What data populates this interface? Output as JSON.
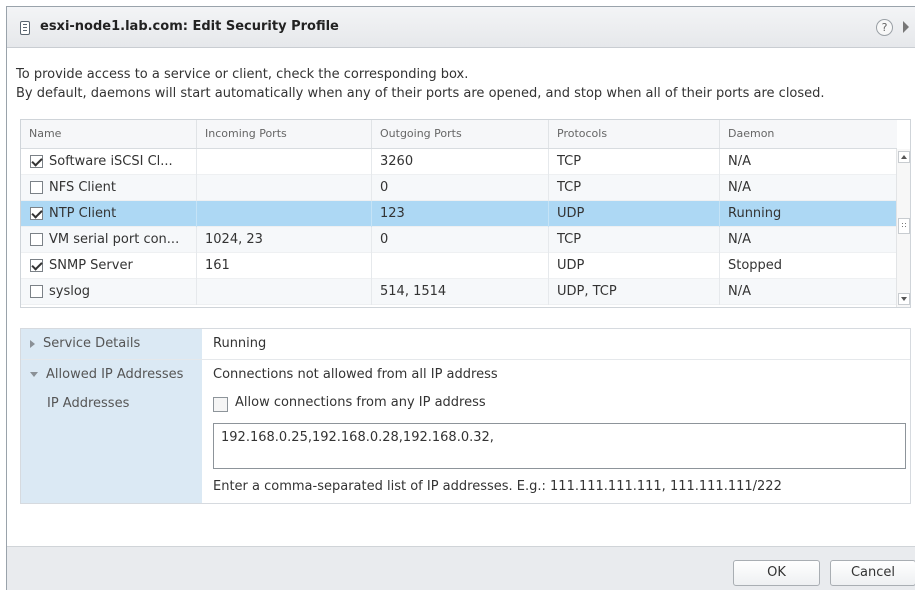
{
  "dialog": {
    "title": "esxi-node1.lab.com: Edit Security Profile",
    "help_glyph": "?",
    "intro_line1": "To provide access to a service or client, check the corresponding box.",
    "intro_line2": "By default, daemons will start automatically when any of their ports are opened, and stop when all of their ports are closed."
  },
  "grid": {
    "columns": [
      "Name",
      "Incoming Ports",
      "Outgoing Ports",
      "Protocols",
      "Daemon"
    ],
    "rows": [
      {
        "checked": true,
        "name": "Software iSCSI Cl...",
        "incoming": "",
        "outgoing": "3260",
        "protocols": "TCP",
        "daemon": "N/A"
      },
      {
        "checked": false,
        "name": "NFS Client",
        "incoming": "",
        "outgoing": "0",
        "protocols": "TCP",
        "daemon": "N/A"
      },
      {
        "checked": true,
        "name": "NTP Client",
        "incoming": "",
        "outgoing": "123",
        "protocols": "UDP",
        "daemon": "Running",
        "selected": true
      },
      {
        "checked": false,
        "name": "VM serial port con...",
        "incoming": "1024, 23",
        "outgoing": "0",
        "protocols": "TCP",
        "daemon": "N/A"
      },
      {
        "checked": true,
        "name": "SNMP Server",
        "incoming": "161",
        "outgoing": "",
        "protocols": "UDP",
        "daemon": "Stopped"
      },
      {
        "checked": false,
        "name": "syslog",
        "incoming": "",
        "outgoing": "514, 1514",
        "protocols": "UDP, TCP",
        "daemon": "N/A"
      }
    ]
  },
  "details": {
    "service_details_label": "Service Details",
    "service_details_value": "Running",
    "allowed_ip_label": "Allowed IP Addresses",
    "allowed_ip_value": "Connections not allowed from all IP address",
    "ip_addresses_label": "IP Addresses",
    "allow_any_label": "Allow connections from any IP address",
    "allow_any_checked": false,
    "ip_list": "192.168.0.25,192.168.0.28,192.168.0.32,",
    "hint": "Enter a comma-separated list of IP addresses. E.g.: 111.111.111.111, 111.111.111/222"
  },
  "footer": {
    "ok_label": "OK",
    "cancel_label": "Cancel"
  }
}
